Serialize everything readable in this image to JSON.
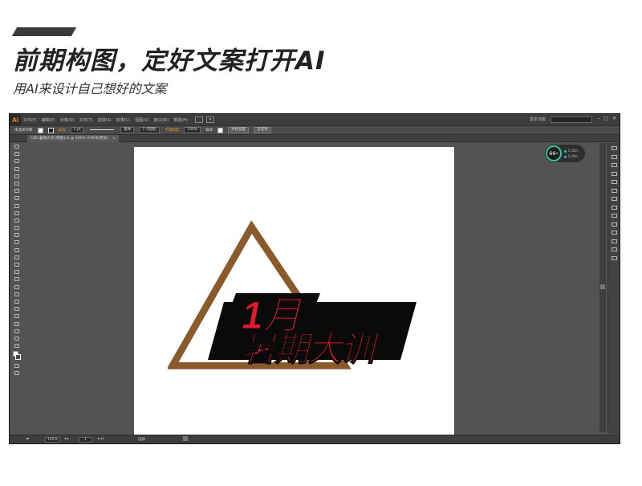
{
  "headline": "前期构图，定好文案打开AI",
  "subheadline": "用AI来设计自己想好的文案",
  "app": {
    "logo": "Ai",
    "menu": [
      "文件(F)",
      "编辑(E)",
      "对象(O)",
      "文字(T)",
      "选择(S)",
      "效果(C)",
      "视图(V)",
      "窗口(W)",
      "帮助(H)"
    ],
    "workspace": "基本功能",
    "window_controls": [
      "–",
      "□",
      "✕"
    ]
  },
  "control_bar": {
    "selection": "未选择对象",
    "stroke_label": "描边",
    "stroke_weight": "1 pt",
    "brush": "基本",
    "style_dot": "5 点圆形",
    "opacity_label": "不透明度",
    "opacity": "100%",
    "style_label": "样式",
    "doc_setup": "文档设置",
    "preferences": "首选项"
  },
  "doc_tab": {
    "title": "C4D 暑期大训 [转换].ai @ 100% (CMYK/预览)",
    "close": "×"
  },
  "artwork": {
    "line1": "1月",
    "line2": "暑期大训",
    "triangle_color": "#8b5a2b",
    "text_color": "#e21a2c",
    "band_color": "#0a0a0a"
  },
  "perf_widget": {
    "value": "66",
    "unit": "%",
    "up": "0.1K/s",
    "down": "0.2K/s"
  },
  "status_bar": {
    "zoom": "100%",
    "page": "1",
    "tool": "选择"
  }
}
